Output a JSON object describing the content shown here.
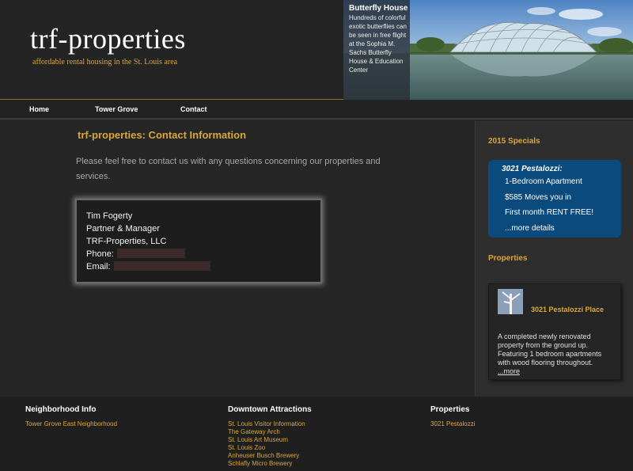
{
  "header": {
    "site_title": "trf-properties",
    "tagline": "affordable rental housing in the St. Louis area",
    "hero_caption_title": "Butterfly House",
    "hero_caption_text": "Hundreds of colorful exotic butterflies can be seen in free flight at the Sophia M. Sachs Butterfly House & Education Center"
  },
  "nav": {
    "items": [
      {
        "label": "Home"
      },
      {
        "label": "Tower Grove"
      },
      {
        "label": "Contact"
      }
    ]
  },
  "main": {
    "heading": "trf-properties:  Contact Information",
    "intro": "Please feel free to contact us with any questions concerning our properties and services.",
    "contact": {
      "name": "Tim Fogerty",
      "title": "Partner & Manager",
      "company": "TRF-Properties, LLC",
      "phone_label": "Phone:",
      "email_label": "Email:"
    }
  },
  "sidebar": {
    "specials_heading": "2015 Specials",
    "special": {
      "title": "3021 Pestalozzi:",
      "lines": [
        "1-Bedroom Apartment",
        "$585 Moves you in",
        "First month RENT FREE!",
        "...more details"
      ]
    },
    "properties_heading": "Properties",
    "property": {
      "name": "3021 Pestalozzi Place",
      "description": "A completed newly renovated property from the ground up. Featuring 1 bedroom apartments with wood flooring throughout.",
      "more_label": "...more"
    }
  },
  "footer": {
    "columns": [
      {
        "heading": "Neighborhood Info",
        "links": [
          "Tower Grove East Neighborhood"
        ]
      },
      {
        "heading": "Downtown Attractions",
        "links": [
          "St. Louis Visitor Information",
          "The Gateway Arch",
          "St. Louis Art Museum",
          "St. Louis Zoo",
          "Anheuser Busch Brewery",
          "Schlafly Micro Brewery"
        ]
      },
      {
        "heading": "Properties",
        "links": [
          "3021 Pestalozzi"
        ]
      }
    ]
  },
  "colors": {
    "accent": "#d9a63a",
    "special_box": "#0a4a7c",
    "background": "#262626"
  }
}
